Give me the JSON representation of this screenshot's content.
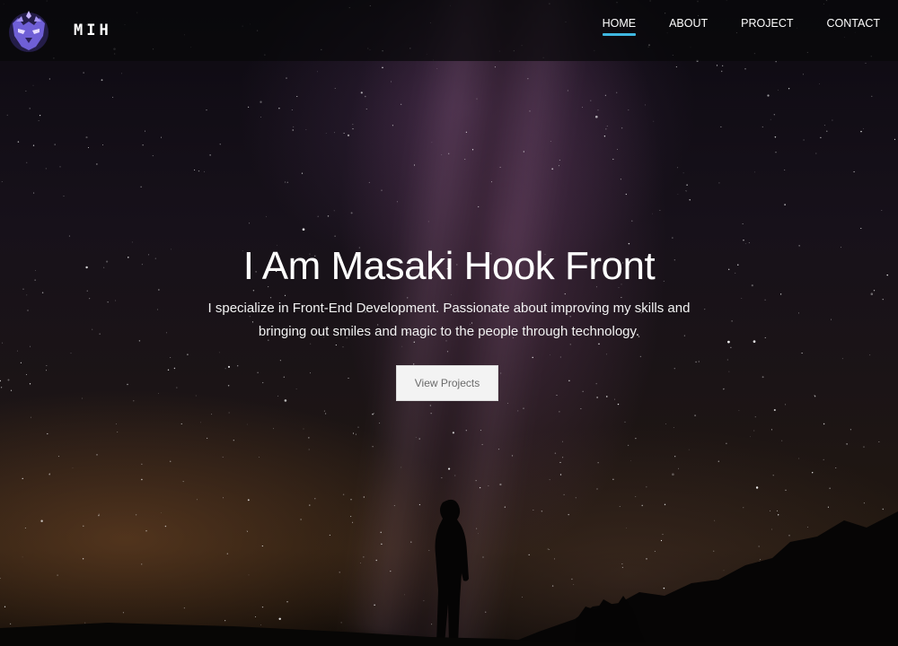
{
  "brand": {
    "name": "MIH",
    "logo_icon": "wolf-mask-icon"
  },
  "nav": {
    "items": [
      {
        "label": "HOME",
        "active": true
      },
      {
        "label": "ABOUT",
        "active": false
      },
      {
        "label": "PROJECT",
        "active": false
      },
      {
        "label": "CONTACT",
        "active": false
      }
    ]
  },
  "hero": {
    "title": "I Am Masaki Hook Front",
    "subtitle": "I specialize in Front-End Development. Passionate about improving my skills and bringing out smiles and magic to the people through technology.",
    "button_label": "View Projects"
  },
  "colors": {
    "nav_active_underline": "#3fb7e0",
    "button_bg": "#f3f3f3",
    "button_text": "#6b6b6b"
  }
}
